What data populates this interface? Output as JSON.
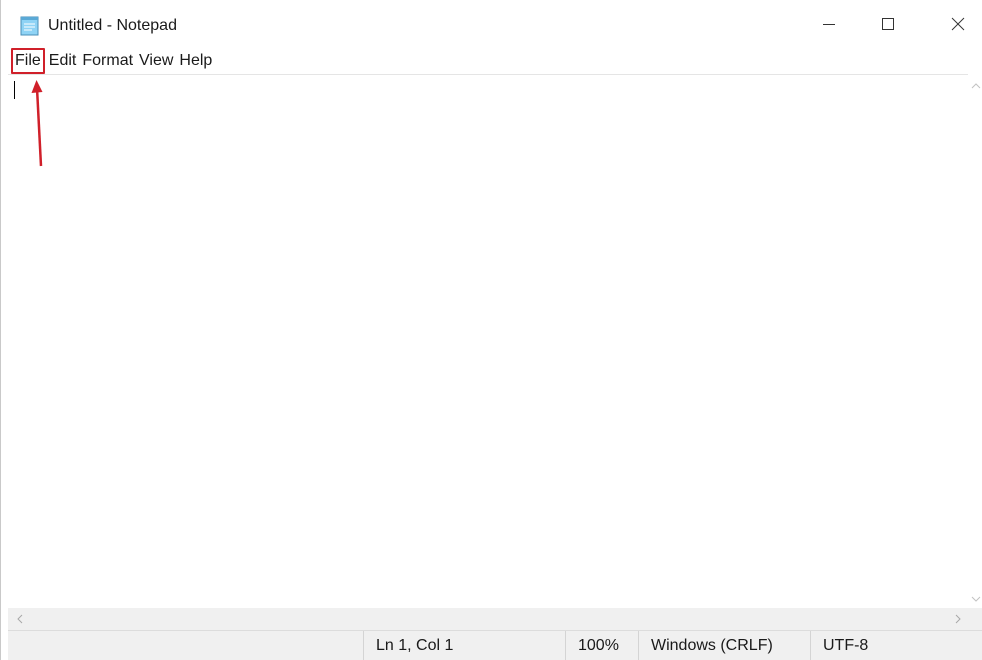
{
  "window": {
    "title": "Untitled - Notepad",
    "icon": "notepad-icon"
  },
  "controls": {
    "minimize_icon": "minimize-icon",
    "maximize_icon": "maximize-icon",
    "close_icon": "close-icon"
  },
  "menu": {
    "items": [
      {
        "label": "File"
      },
      {
        "label": "Edit"
      },
      {
        "label": "Format"
      },
      {
        "label": "View"
      },
      {
        "label": "Help"
      }
    ],
    "highlight_color": "#d0202a"
  },
  "editor": {
    "content": ""
  },
  "status": {
    "position": "Ln 1, Col 1",
    "zoom": "100%",
    "line_ending": "Windows (CRLF)",
    "encoding": "UTF-8"
  },
  "annotation": {
    "arrow_color": "#d0202a"
  }
}
